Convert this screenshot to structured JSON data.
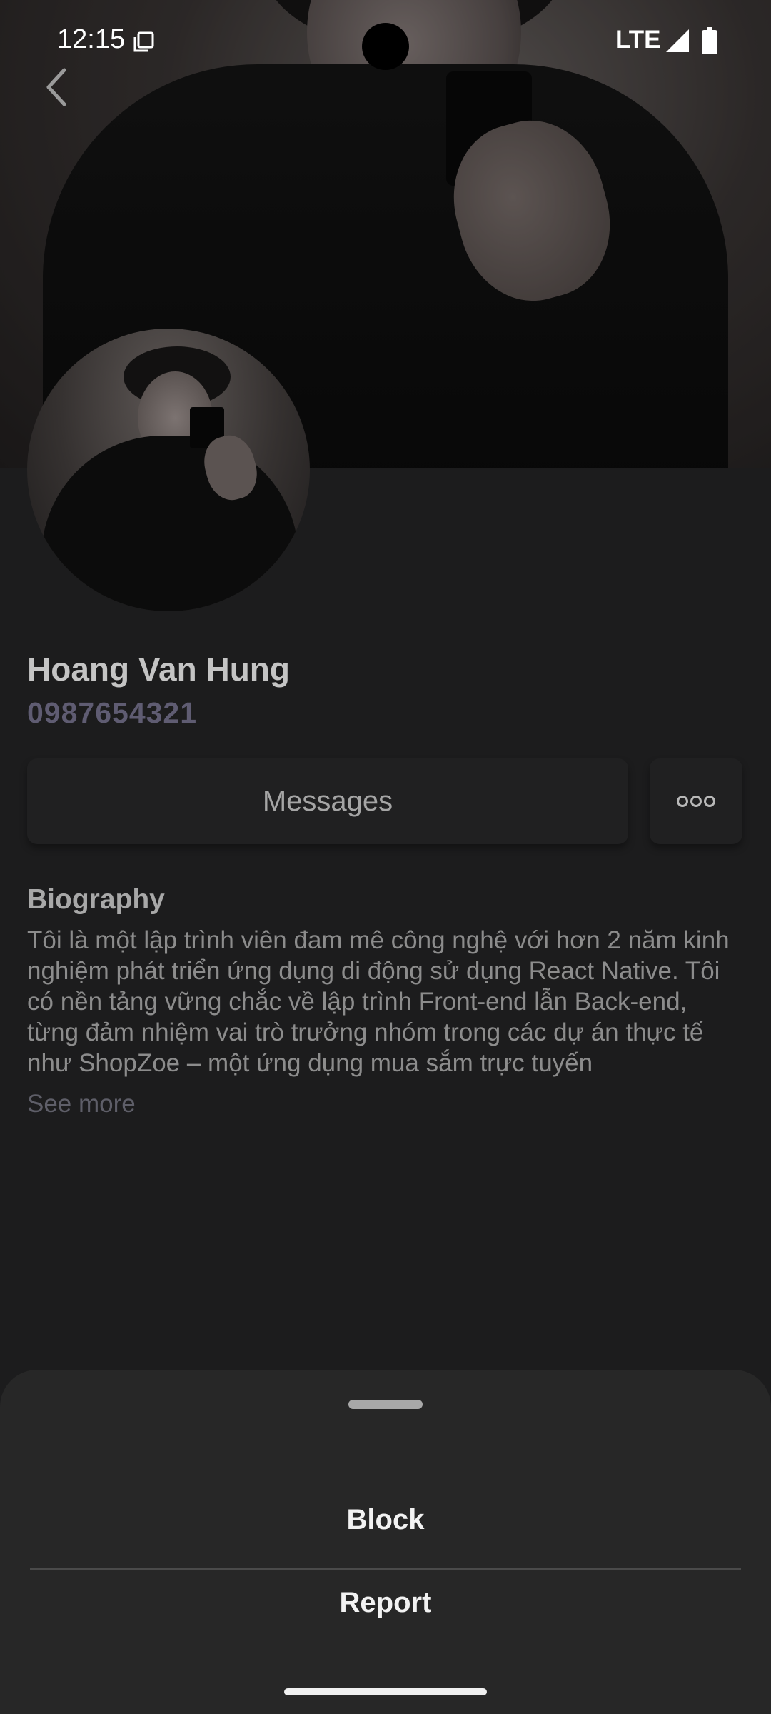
{
  "status_bar": {
    "time": "12:15",
    "network": "LTE",
    "icons": [
      "copy-icon",
      "signal-icon",
      "battery-icon"
    ]
  },
  "profile": {
    "name": "Hoang Van Hung",
    "phone": "0987654321",
    "messages_label": "Messages",
    "biography_title": "Biography",
    "biography_text": "Tôi là một lập trình viên đam mê công nghệ với hơn 2 năm kinh nghiệm phát triển ứng dụng di động sử dụng React Native. Tôi có nền tảng vững chắc về lập trình Front-end lẫn Back-end, từng đảm nhiệm vai trò trưởng nhóm trong các dự án thực tế như ShopZoe – một ứng dụng mua sắm trực tuyến",
    "see_more_label": "See more"
  },
  "sheet": {
    "block_label": "Block",
    "report_label": "Report"
  },
  "colors": {
    "background": "#1c1c1d",
    "sheet": "#272727",
    "phone_text": "#5f5c72"
  }
}
